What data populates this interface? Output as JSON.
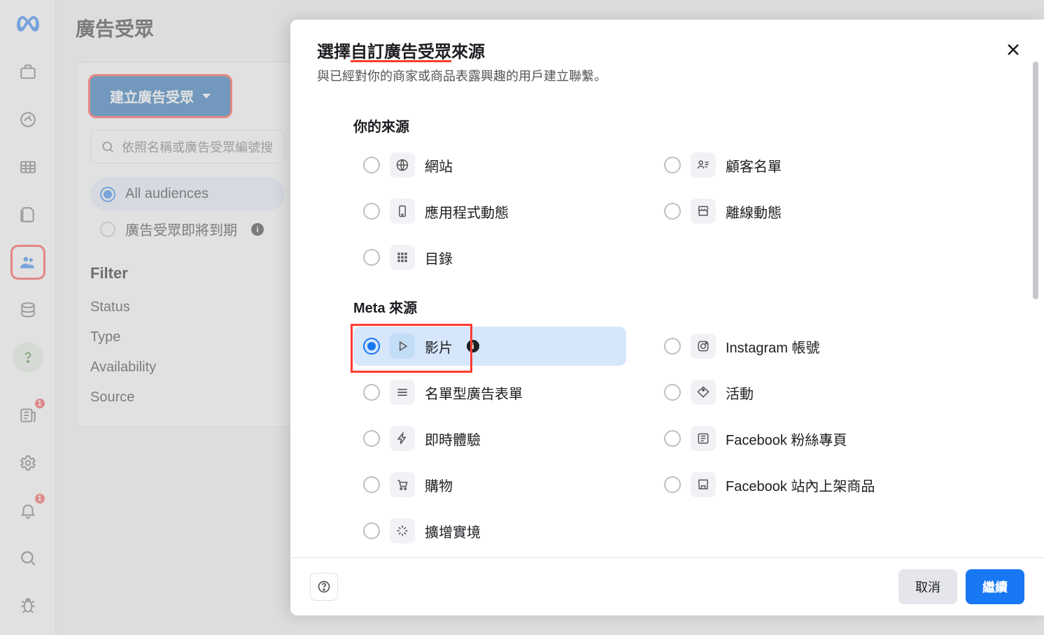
{
  "page": {
    "title": "廣告受眾",
    "create_btn": "建立廣告受眾",
    "search_placeholder": "依照名稱或廣告受眾編號搜",
    "aud_all": "All audiences",
    "aud_expiring": "廣告受眾即將到期",
    "filter_head": "Filter",
    "filter_status": "Status",
    "filter_type": "Type",
    "filter_availability": "Availability",
    "filter_source": "Source"
  },
  "rail": {
    "news_badge": "1",
    "bell_badge": "1"
  },
  "modal": {
    "title_pre": "選擇",
    "title_ul": "自訂廣告受眾",
    "title_post": "來源",
    "subtitle": "與已經對你的商家或商品表露興趣的用戶建立聯繫。",
    "section_your": "你的來源",
    "section_meta": "Meta 來源",
    "cancel": "取消",
    "continue": "繼續",
    "your_sources": {
      "website": "網站",
      "customer_list": "顧客名單",
      "app_activity": "應用程式動態",
      "offline_activity": "離線動態",
      "catalog": "目錄"
    },
    "meta_sources": {
      "video": "影片",
      "instagram": "Instagram 帳號",
      "lead_form": "名單型廣告表單",
      "events": "活動",
      "instant_exp": "即時體驗",
      "fb_page": "Facebook 粉絲專頁",
      "shopping": "購物",
      "fb_listings": "Facebook 站內上架商品",
      "ar": "擴增實境"
    }
  }
}
